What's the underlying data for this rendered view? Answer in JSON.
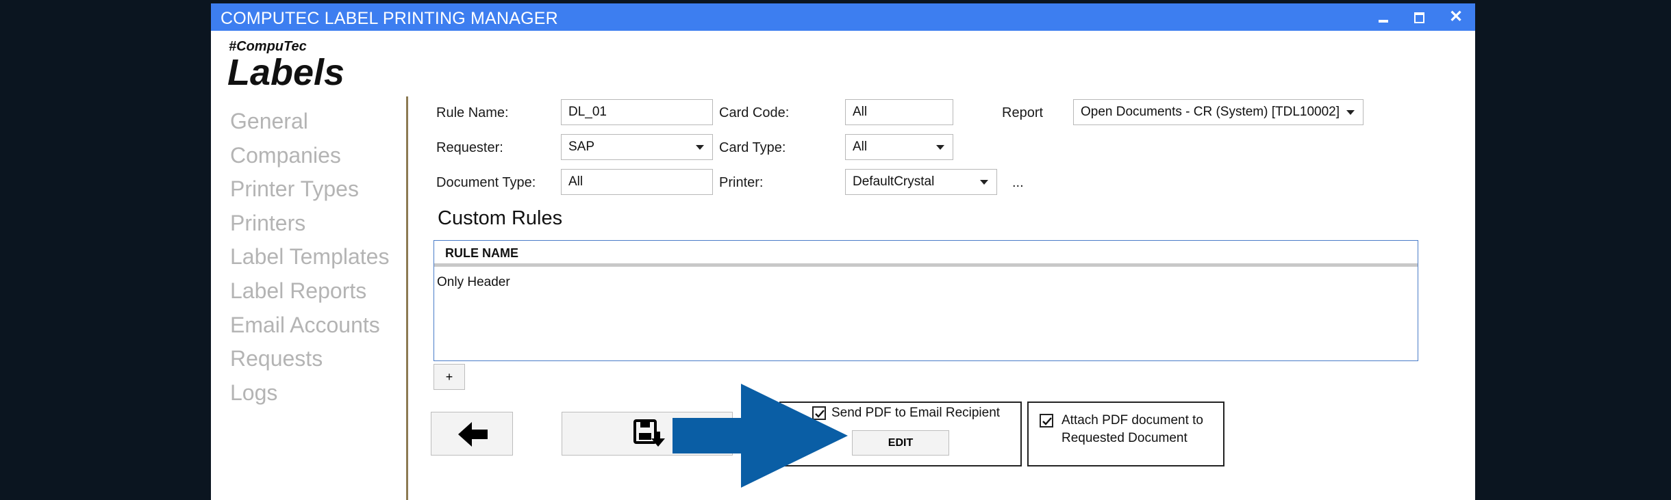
{
  "window": {
    "title": "COMPUTEC LABEL PRINTING MANAGER"
  },
  "logo": {
    "tag": "#CompuTec",
    "main": "Labels"
  },
  "nav": {
    "items": [
      "General",
      "Companies",
      "Printer Types",
      "Printers",
      "Label Templates",
      "Label Reports",
      "Email Accounts",
      "Requests",
      "Logs"
    ]
  },
  "form": {
    "rule_name": {
      "label": "Rule Name:",
      "value": "DL_01"
    },
    "card_code": {
      "label": "Card Code:",
      "value": "All"
    },
    "report": {
      "label": "Report",
      "value": "Open Documents - CR (System)  [TDL10002]"
    },
    "requester": {
      "label": "Requester:",
      "value": "SAP"
    },
    "card_type": {
      "label": "Card Type:",
      "value": "All"
    },
    "document_type": {
      "label": "Document Type:",
      "value": "All"
    },
    "printer": {
      "label": "Printer:",
      "value": "DefaultCrystal",
      "more": "..."
    }
  },
  "custom_rules": {
    "title": "Custom Rules",
    "column": "RULE NAME",
    "rows": [
      "Only Header"
    ],
    "add_label": "+"
  },
  "email": {
    "send_pdf_label": "Send PDF to Email Recipient",
    "send_pdf_checked": true,
    "edit_label": "EDIT"
  },
  "attach": {
    "label_line1": "Attach PDF document to",
    "label_line2": "Requested Document",
    "checked": true
  },
  "colors": {
    "titlebar": "#3d7ef0",
    "annotation_arrow": "#0a5ea5",
    "nav_text": "#b4b4b4",
    "background": "#0b1520"
  }
}
